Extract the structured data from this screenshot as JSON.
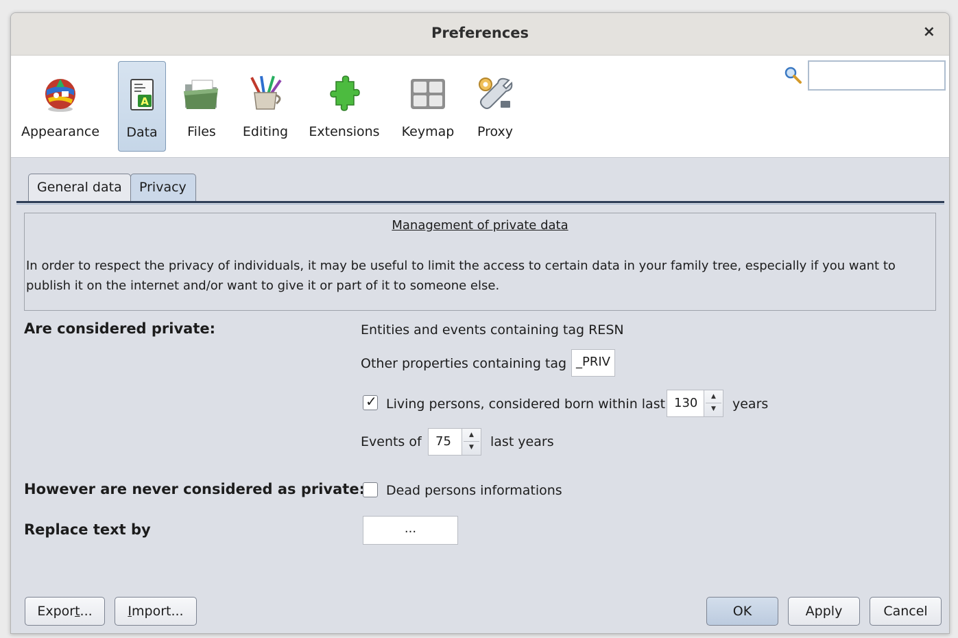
{
  "window": {
    "title": "Preferences",
    "close_glyph": "×"
  },
  "categories": [
    {
      "id": "appearance",
      "label": "Appearance",
      "icon": "globe-flags-icon"
    },
    {
      "id": "data",
      "label": "Data",
      "icon": "data-document-icon",
      "active": true
    },
    {
      "id": "files",
      "label": "Files",
      "icon": "folder-files-icon"
    },
    {
      "id": "editing",
      "label": "Editing",
      "icon": "pencil-cup-icon"
    },
    {
      "id": "extensions",
      "label": "Extensions",
      "icon": "puzzle-piece-icon"
    },
    {
      "id": "keymap",
      "label": "Keymap",
      "icon": "keyboard-keys-icon"
    },
    {
      "id": "proxy",
      "label": "Proxy",
      "icon": "wrench-gear-icon"
    }
  ],
  "search": {
    "value": "",
    "placeholder": ""
  },
  "tabs": [
    {
      "label": "General data",
      "active": false
    },
    {
      "label": "Privacy",
      "active": true
    }
  ],
  "info": {
    "heading": "Management of private data",
    "text": "In order to respect the privacy of individuals, it may be useful to limit the access to certain data in your family tree, especially if you want to publish it on the internet and/or want to give it or part of it to someone else."
  },
  "privacy": {
    "considered_private_label": "Are considered private:",
    "entities_text": "Entities and events containing tag RESN",
    "other_props_label": "Other properties containing tag",
    "other_props_tag": "_PRIV",
    "living_label": "Living persons, considered born within last",
    "living_checked": true,
    "living_years": "130",
    "living_unit": "years",
    "events_label": "Events of",
    "events_years": "75",
    "events_unit": "last years",
    "never_private_label": "However are never considered as private:",
    "dead_label": "Dead persons informations",
    "dead_checked": false,
    "replace_label": "Replace text by",
    "replace_value": "..."
  },
  "buttons": {
    "export": {
      "pre": "Expor",
      "mnemonic": "t",
      "post": "..."
    },
    "import": {
      "pre": "",
      "mnemonic": "I",
      "post": "mport..."
    },
    "ok": "OK",
    "apply": "Apply",
    "cancel": "Cancel"
  },
  "check_glyph": "✓",
  "colors": {
    "active_category": "#c5d6e8",
    "active_tab": "#cbd8e9",
    "dialog_bg": "#dcdfe6"
  }
}
